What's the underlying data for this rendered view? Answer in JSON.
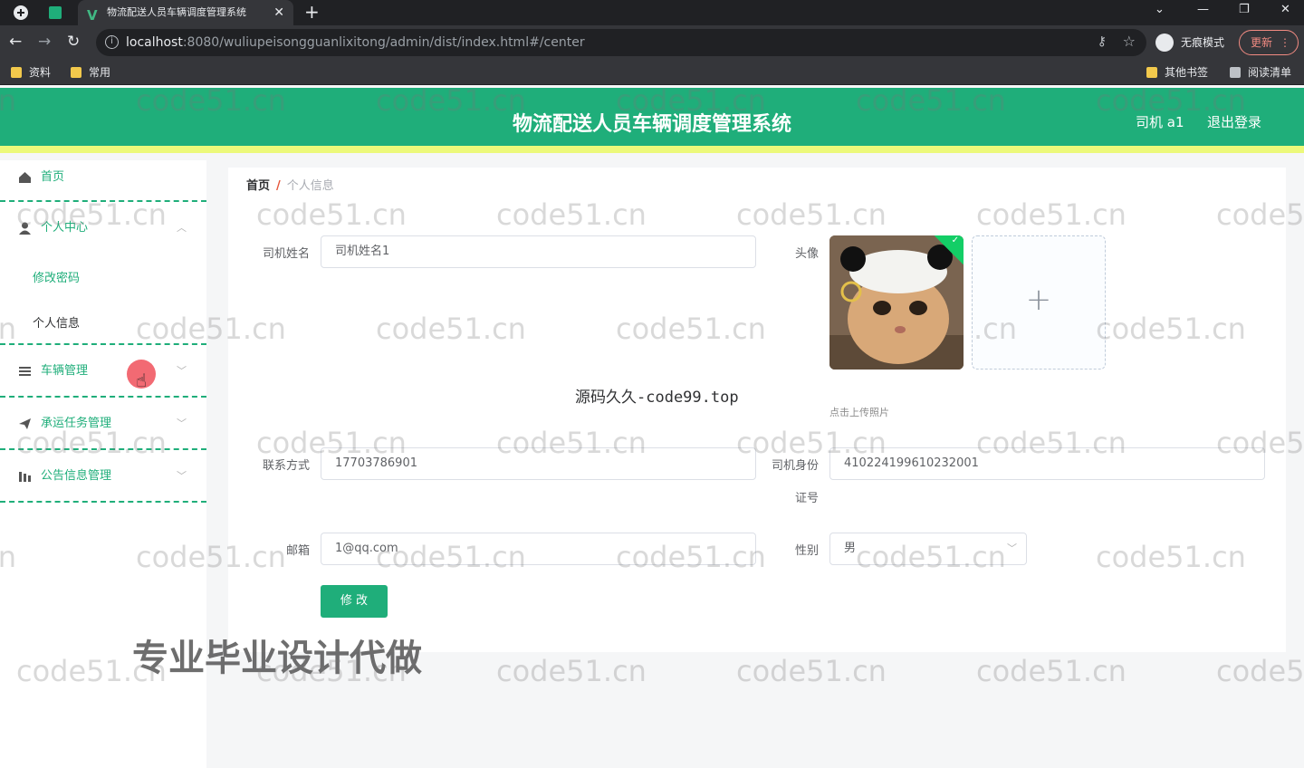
{
  "browser": {
    "tab_title": "物流配送人员车辆调度管理系统",
    "tab_close": "✕",
    "new_tab": "+",
    "url_host": "localhost",
    "url_path": ":8080/wuliupeisongguanlixitong/admin/dist/index.html#/center",
    "incognito_label": "无痕模式",
    "update_label": "更新",
    "window_controls": [
      "⌄",
      "—",
      "❐",
      "✕"
    ],
    "bookmarks": [
      "资料",
      "常用"
    ],
    "bookmarks_right": [
      "其他书签",
      "阅读清单"
    ]
  },
  "header": {
    "title": "物流配送人员车辆调度管理系统",
    "user": "司机 a1",
    "logout": "退出登录"
  },
  "sidebar": {
    "home": "首页",
    "personal_center": "个人中心",
    "change_password": "修改密码",
    "personal_info": "个人信息",
    "vehicle_mgmt": "车辆管理",
    "task_mgmt": "承运任务管理",
    "notice_mgmt": "公告信息管理"
  },
  "breadcrumb": {
    "home": "首页",
    "separator": "/",
    "current": "个人信息"
  },
  "form": {
    "name_label": "司机姓名",
    "name_value": "司机姓名1",
    "avatar_label": "头像",
    "upload_tip": "点击上传照片",
    "upload_plus": "+",
    "phone_label": "联系方式",
    "phone_value": "17703786901",
    "idcard_label_1": "司机身份",
    "idcard_label_2": "证号",
    "idcard_value": "410224199610232001",
    "email_label": "邮箱",
    "email_value": "1@qq.com",
    "gender_label": "性别",
    "gender_value": "男",
    "submit": "修 改"
  },
  "overlay": {
    "center_note": "源码久久-code99.top",
    "promo": "专业毕业设计代做",
    "watermark": "code51.cn"
  },
  "colors": {
    "brand": "#1fae7a",
    "header_stripe": "#ecf97a",
    "crumb_sep": "#e6553a"
  }
}
